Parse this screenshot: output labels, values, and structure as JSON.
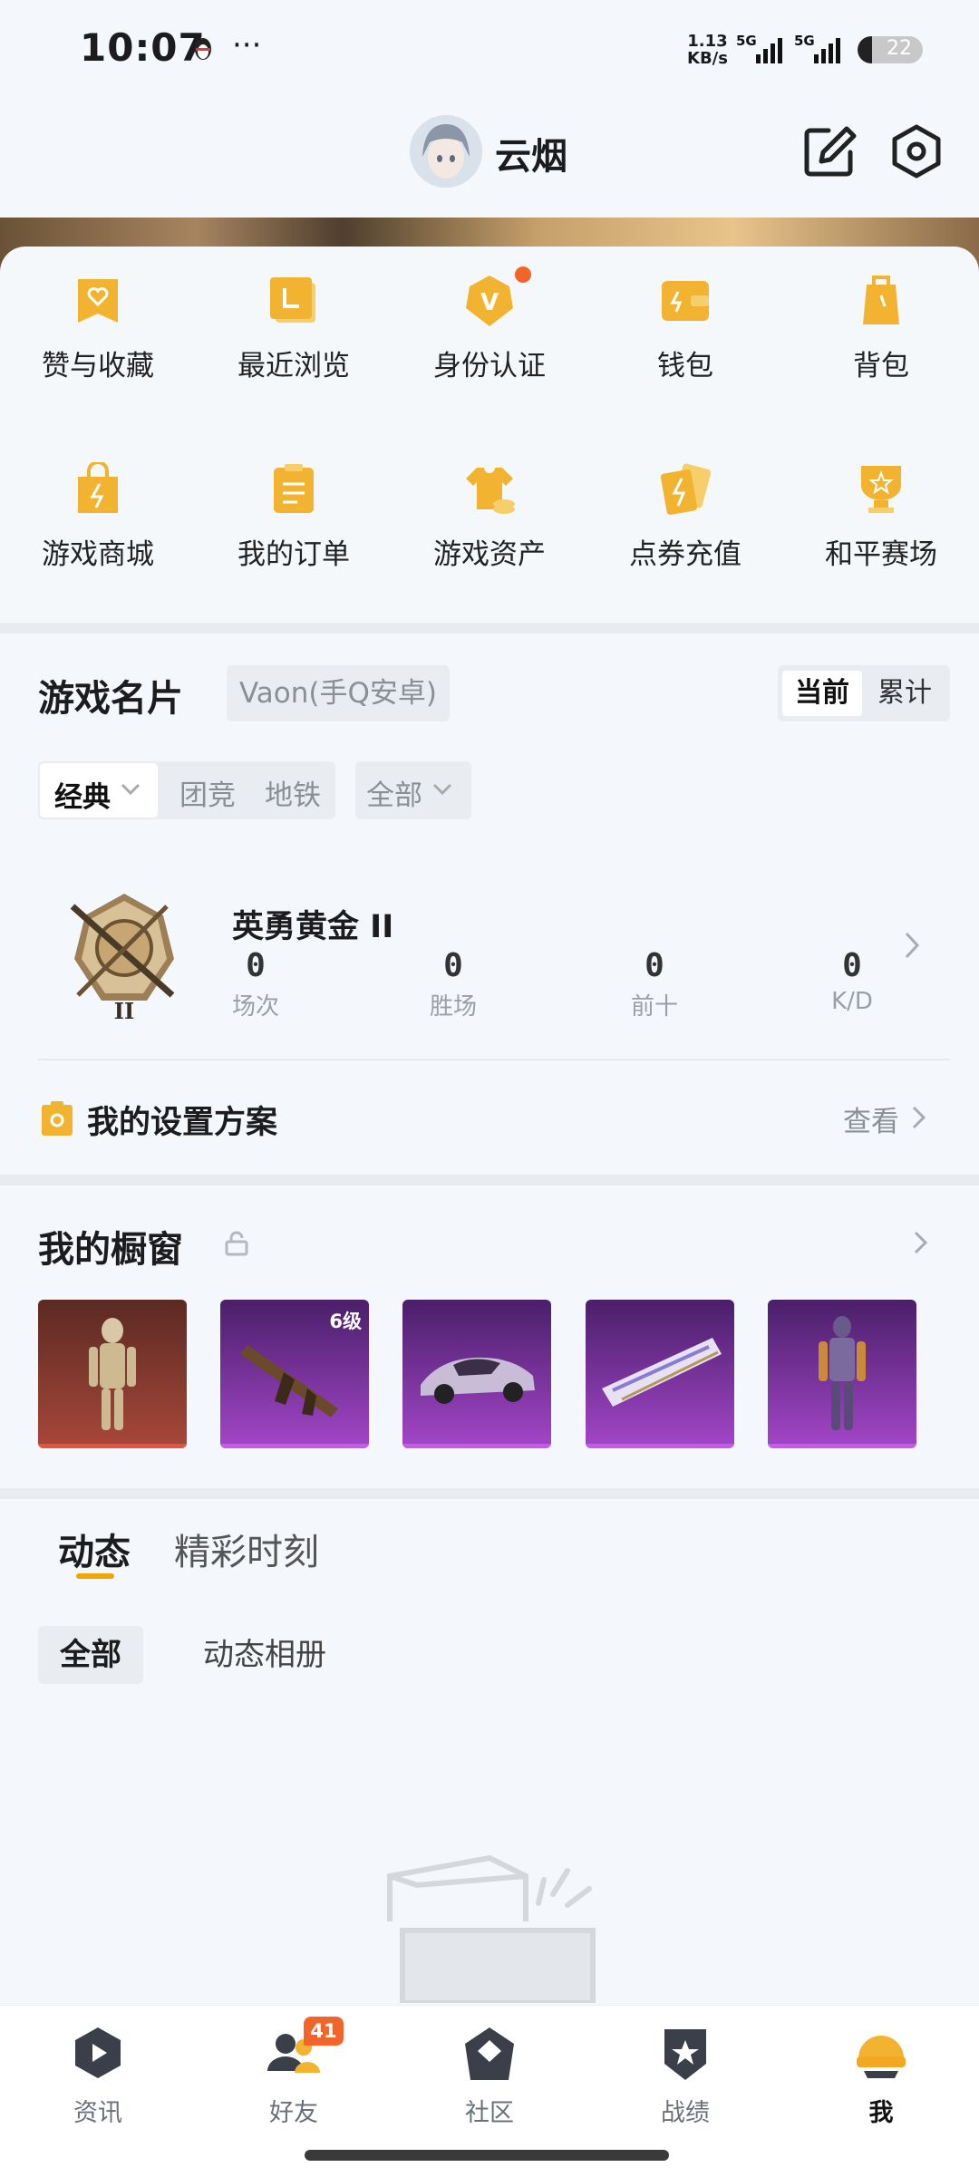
{
  "status_bar": {
    "time": "10:07",
    "speed_top": "1.13",
    "speed_bottom": "KB/s",
    "network1": "5G",
    "network2": "5G",
    "battery": "22"
  },
  "header": {
    "username": "云烟"
  },
  "quick_menu": [
    {
      "label": "赞与收藏",
      "icon": "heart-bookmark-icon"
    },
    {
      "label": "最近浏览",
      "icon": "recent-history-icon"
    },
    {
      "label": "身份认证",
      "icon": "verified-badge-icon",
      "dot": true
    },
    {
      "label": "钱包",
      "icon": "wallet-icon"
    },
    {
      "label": "背包",
      "icon": "backpack-icon"
    },
    {
      "label": "游戏商城",
      "icon": "shopping-bag-icon"
    },
    {
      "label": "我的订单",
      "icon": "order-list-icon"
    },
    {
      "label": "游戏资产",
      "icon": "tshirt-coin-icon"
    },
    {
      "label": "点券充值",
      "icon": "coupon-cards-icon"
    },
    {
      "label": "和平赛场",
      "icon": "trophy-icon"
    }
  ],
  "game_card": {
    "title": "游戏名片",
    "account": "Vaon(手Q安卓)",
    "toggle": {
      "current": "当前",
      "cumulative": "累计"
    },
    "modes": {
      "selected": "经典",
      "option1": "团竞",
      "option2": "地铁",
      "filter": "全部"
    },
    "rank_name": "英勇黄金 II",
    "stats": [
      {
        "value": "0",
        "label": "场次"
      },
      {
        "value": "0",
        "label": "胜场"
      },
      {
        "value": "0",
        "label": "前十"
      },
      {
        "value": "0",
        "label": "K/D"
      }
    ],
    "settings_title": "我的设置方案",
    "settings_link": "查看"
  },
  "showcase": {
    "title": "我的橱窗",
    "items": [
      {
        "name": "mummy-outfit",
        "level": ""
      },
      {
        "name": "assault-rifle",
        "level": "6级"
      },
      {
        "name": "sports-car",
        "level": ""
      },
      {
        "name": "glider",
        "level": ""
      },
      {
        "name": "mech-suit",
        "level": ""
      }
    ]
  },
  "feed": {
    "tabs": [
      "动态",
      "精彩时刻"
    ],
    "subtabs": [
      "全部",
      "动态相册"
    ]
  },
  "bottom_nav": [
    {
      "label": "资讯",
      "icon": "news-play-icon"
    },
    {
      "label": "好友",
      "icon": "friends-icon",
      "badge": "41"
    },
    {
      "label": "社区",
      "icon": "community-house-icon"
    },
    {
      "label": "战绩",
      "icon": "battle-record-icon"
    },
    {
      "label": "我",
      "icon": "helmet-profile-icon"
    }
  ],
  "colors": {
    "accent": "#f0a500",
    "badge": "#f2652a",
    "background": "#f4f7fb"
  }
}
